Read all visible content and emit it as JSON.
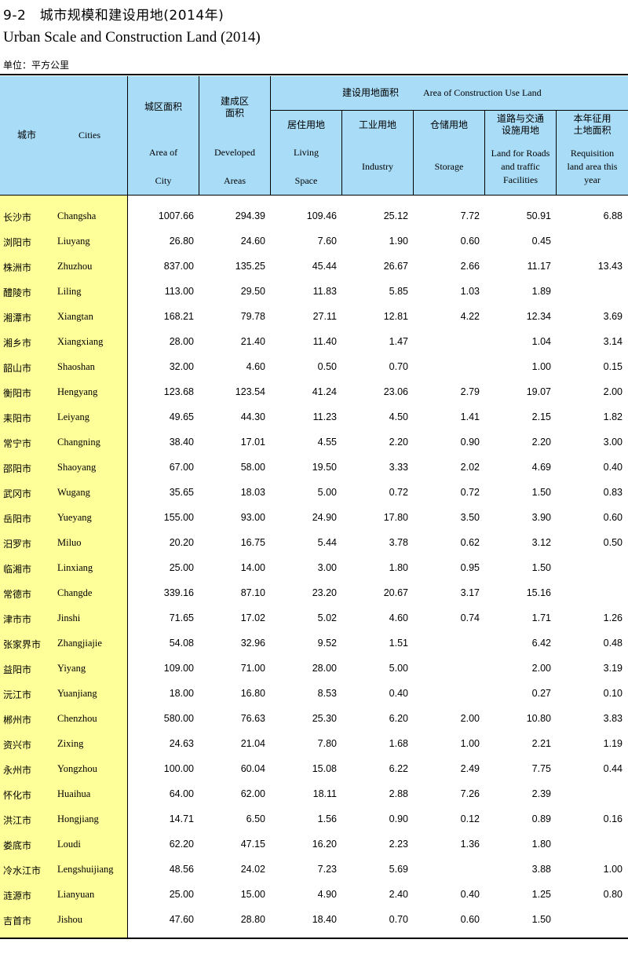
{
  "title_cn": "9-2　城市规模和建设用地(2014年)",
  "title_en": "Urban Scale and Construction Land (2014)",
  "unit": "单位：平方公里",
  "headers": {
    "city_cn": "城市",
    "city_en": "Cities",
    "area_cn": "城区面积",
    "area_en1": "Area of",
    "area_en2": "City",
    "dev_cn1": "建成区",
    "dev_cn2": "面积",
    "dev_en1": "Developed",
    "dev_en2": "Areas",
    "construction_cn": "建设用地面积",
    "construction_en": "Area of Construction Use Land",
    "living_cn": "居住用地",
    "living_en1": "Living",
    "living_en2": "Space",
    "industry_cn": "工业用地",
    "industry_en": "Industry",
    "storage_cn": "仓储用地",
    "storage_en": "Storage",
    "roads_cn1": "道路与交通",
    "roads_cn2": "设施用地",
    "roads_en1": "Land for Roads",
    "roads_en2": "and traffic",
    "roads_en3": "Facilities",
    "req_cn1": "本年征用",
    "req_cn2": "土地面积",
    "req_en1": "Requisition",
    "req_en2": "land area this",
    "req_en3": "year"
  },
  "rows": [
    {
      "cn": "长沙市",
      "en": "Changsha",
      "area": "1007.66",
      "dev": "294.39",
      "living": "109.46",
      "industry": "25.12",
      "storage": "7.72",
      "roads": "50.91",
      "req": "6.88"
    },
    {
      "cn": "浏阳市",
      "en": "Liuyang",
      "area": "26.80",
      "dev": "24.60",
      "living": "7.60",
      "industry": "1.90",
      "storage": "0.60",
      "roads": "0.45",
      "req": ""
    },
    {
      "cn": "株洲市",
      "en": "Zhuzhou",
      "area": "837.00",
      "dev": "135.25",
      "living": "45.44",
      "industry": "26.67",
      "storage": "2.66",
      "roads": "11.17",
      "req": "13.43"
    },
    {
      "cn": "醴陵市",
      "en": "Liling",
      "area": "113.00",
      "dev": "29.50",
      "living": "11.83",
      "industry": "5.85",
      "storage": "1.03",
      "roads": "1.89",
      "req": ""
    },
    {
      "cn": "湘潭市",
      "en": "Xiangtan",
      "area": "168.21",
      "dev": "79.78",
      "living": "27.11",
      "industry": "12.81",
      "storage": "4.22",
      "roads": "12.34",
      "req": "3.69"
    },
    {
      "cn": "湘乡市",
      "en": "Xiangxiang",
      "area": "28.00",
      "dev": "21.40",
      "living": "11.40",
      "industry": "1.47",
      "storage": "",
      "roads": "1.04",
      "req": "3.14"
    },
    {
      "cn": "韶山市",
      "en": "Shaoshan",
      "area": "32.00",
      "dev": "4.60",
      "living": "0.50",
      "industry": "0.70",
      "storage": "",
      "roads": "1.00",
      "req": "0.15"
    },
    {
      "cn": "衡阳市",
      "en": "Hengyang",
      "area": "123.68",
      "dev": "123.54",
      "living": "41.24",
      "industry": "23.06",
      "storage": "2.79",
      "roads": "19.07",
      "req": "2.00"
    },
    {
      "cn": "耒阳市",
      "en": "Leiyang",
      "area": "49.65",
      "dev": "44.30",
      "living": "11.23",
      "industry": "4.50",
      "storage": "1.41",
      "roads": "2.15",
      "req": "1.82"
    },
    {
      "cn": "常宁市",
      "en": "Changning",
      "area": "38.40",
      "dev": "17.01",
      "living": "4.55",
      "industry": "2.20",
      "storage": "0.90",
      "roads": "2.20",
      "req": "3.00"
    },
    {
      "cn": "邵阳市",
      "en": "Shaoyang",
      "area": "67.00",
      "dev": "58.00",
      "living": "19.50",
      "industry": "3.33",
      "storage": "2.02",
      "roads": "4.69",
      "req": "0.40"
    },
    {
      "cn": "武冈市",
      "en": "Wugang",
      "area": "35.65",
      "dev": "18.03",
      "living": "5.00",
      "industry": "0.72",
      "storage": "0.72",
      "roads": "1.50",
      "req": "0.83"
    },
    {
      "cn": "岳阳市",
      "en": "Yueyang",
      "area": "155.00",
      "dev": "93.00",
      "living": "24.90",
      "industry": "17.80",
      "storage": "3.50",
      "roads": "3.90",
      "req": "0.60"
    },
    {
      "cn": "汨罗市",
      "en": "Miluo",
      "area": "20.20",
      "dev": "16.75",
      "living": "5.44",
      "industry": "3.78",
      "storage": "0.62",
      "roads": "3.12",
      "req": "0.50"
    },
    {
      "cn": "临湘市",
      "en": "Linxiang",
      "area": "25.00",
      "dev": "14.00",
      "living": "3.00",
      "industry": "1.80",
      "storage": "0.95",
      "roads": "1.50",
      "req": ""
    },
    {
      "cn": "常德市",
      "en": "Changde",
      "area": "339.16",
      "dev": "87.10",
      "living": "23.20",
      "industry": "20.67",
      "storage": "3.17",
      "roads": "15.16",
      "req": ""
    },
    {
      "cn": "津市市",
      "en": "Jinshi",
      "area": "71.65",
      "dev": "17.02",
      "living": "5.02",
      "industry": "4.60",
      "storage": "0.74",
      "roads": "1.71",
      "req": "1.26"
    },
    {
      "cn": "张家界市",
      "en": "Zhangjiajie",
      "area": "54.08",
      "dev": "32.96",
      "living": "9.52",
      "industry": "1.51",
      "storage": "",
      "roads": "6.42",
      "req": "0.48"
    },
    {
      "cn": "益阳市",
      "en": "Yiyang",
      "area": "109.00",
      "dev": "71.00",
      "living": "28.00",
      "industry": "5.00",
      "storage": "",
      "roads": "2.00",
      "req": "3.19"
    },
    {
      "cn": "沅江市",
      "en": "Yuanjiang",
      "area": "18.00",
      "dev": "16.80",
      "living": "8.53",
      "industry": "0.40",
      "storage": "",
      "roads": "0.27",
      "req": "0.10"
    },
    {
      "cn": "郴州市",
      "en": "Chenzhou",
      "area": "580.00",
      "dev": "76.63",
      "living": "25.30",
      "industry": "6.20",
      "storage": "2.00",
      "roads": "10.80",
      "req": "3.83"
    },
    {
      "cn": "资兴市",
      "en": "Zixing",
      "area": "24.63",
      "dev": "21.04",
      "living": "7.80",
      "industry": "1.68",
      "storage": "1.00",
      "roads": "2.21",
      "req": "1.19"
    },
    {
      "cn": "永州市",
      "en": "Yongzhou",
      "area": "100.00",
      "dev": "60.04",
      "living": "15.08",
      "industry": "6.22",
      "storage": "2.49",
      "roads": "7.75",
      "req": "0.44"
    },
    {
      "cn": "怀化市",
      "en": "Huaihua",
      "area": "64.00",
      "dev": "62.00",
      "living": "18.11",
      "industry": "2.88",
      "storage": "7.26",
      "roads": "2.39",
      "req": ""
    },
    {
      "cn": "洪江市",
      "en": "Hongjiang",
      "area": "14.71",
      "dev": "6.50",
      "living": "1.56",
      "industry": "0.90",
      "storage": "0.12",
      "roads": "0.89",
      "req": "0.16"
    },
    {
      "cn": "娄底市",
      "en": "Loudi",
      "area": "62.20",
      "dev": "47.15",
      "living": "16.20",
      "industry": "2.23",
      "storage": "1.36",
      "roads": "1.80",
      "req": ""
    },
    {
      "cn": "冷水江市",
      "en": "Lengshuijiang",
      "area": "48.56",
      "dev": "24.02",
      "living": "7.23",
      "industry": "5.69",
      "storage": "",
      "roads": "3.88",
      "req": "1.00"
    },
    {
      "cn": "涟源市",
      "en": "Lianyuan",
      "area": "25.00",
      "dev": "15.00",
      "living": "4.90",
      "industry": "2.40",
      "storage": "0.40",
      "roads": "1.25",
      "req": "0.80"
    },
    {
      "cn": "吉首市",
      "en": "Jishou",
      "area": "47.60",
      "dev": "28.80",
      "living": "18.40",
      "industry": "0.70",
      "storage": "0.60",
      "roads": "1.50",
      "req": ""
    }
  ]
}
